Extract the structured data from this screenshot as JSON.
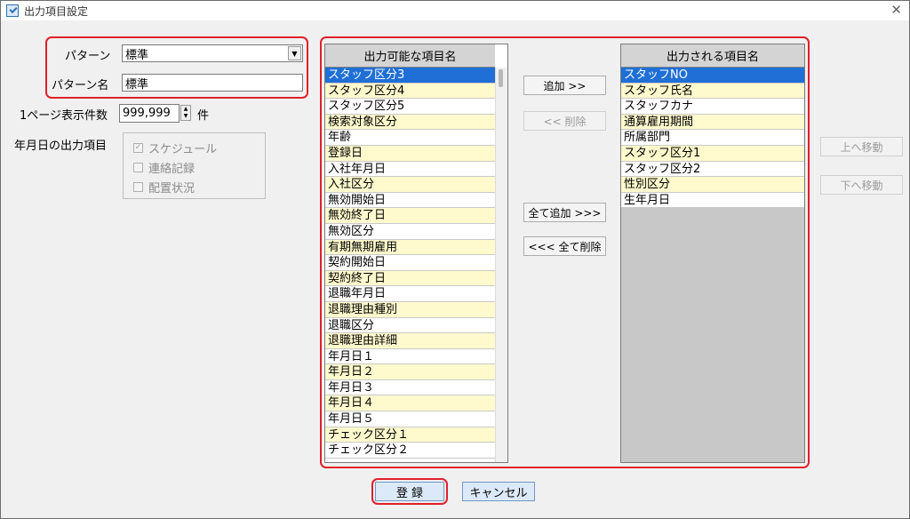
{
  "window": {
    "title": "出力項目設定",
    "close_glyph": "✕"
  },
  "pattern": {
    "label": "パターン",
    "value": "標準",
    "name_label": "パターン名",
    "name_value": "標準"
  },
  "per_page": {
    "label": "1ページ表示件数",
    "value": "999,999",
    "unit": "件"
  },
  "date_output": {
    "label": "年月日の出力項目",
    "options": [
      {
        "label": "スケジュール",
        "checked": true
      },
      {
        "label": "連絡記録",
        "checked": false
      },
      {
        "label": "配置状況",
        "checked": false
      }
    ]
  },
  "available_list": {
    "header": "出力可能な項目名",
    "items": [
      "スタッフ区分3",
      "スタッフ区分4",
      "スタッフ区分5",
      "検索対象区分",
      "年齢",
      "登録日",
      "入社年月日",
      "入社区分",
      "無効開始日",
      "無効終了日",
      "無効区分",
      "有期無期雇用",
      "契約開始日",
      "契約終了日",
      "退職年月日",
      "退職理由種別",
      "退職区分",
      "退職理由詳細",
      "年月日１",
      "年月日２",
      "年月日３",
      "年月日４",
      "年月日５",
      "チェック区分１",
      "チェック区分２"
    ],
    "selected_index": 0
  },
  "output_list": {
    "header": "出力される項目名",
    "items": [
      "スタッフNO",
      "スタッフ氏名",
      "スタッフカナ",
      "通算雇用期間",
      "所属部門",
      "スタッフ区分1",
      "スタッフ区分2",
      "性別区分",
      "生年月日"
    ],
    "selected_index": 0
  },
  "buttons": {
    "add": "追加 >>",
    "remove": "<< 削除",
    "add_all": "全て追加 >>>",
    "remove_all": "<<< 全て削除",
    "move_up": "上へ移動",
    "move_down": "下へ移動",
    "register": "登 録",
    "cancel": "キャンセル"
  },
  "colors": {
    "highlight_border": "#e0202a",
    "selection": "#1f6fd6",
    "alt_row": "#fffacd"
  }
}
